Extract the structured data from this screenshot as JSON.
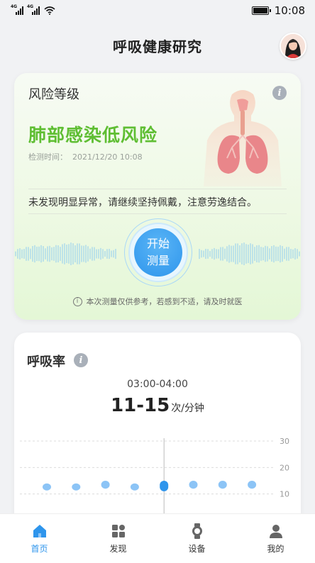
{
  "status_bar": {
    "network1": "4G",
    "network2": "4G",
    "time": "10:08"
  },
  "header": {
    "title": "呼吸健康研究"
  },
  "risk_card": {
    "label": "风险等级",
    "level": "肺部感染低风险",
    "time_label": "检测时间：",
    "time_value": "2021/12/20 10:08",
    "advice": "未发现明显异常，请继续坚持佩戴，注意劳逸结合。",
    "start_line1": "开始",
    "start_line2": "测量",
    "disclaimer": "本次测量仅供参考，若感到不适，请及时就医",
    "level_color": "#5fbe33"
  },
  "resp_card": {
    "title": "呼吸率",
    "time_range": "03:00-04:00",
    "value": "11-15",
    "unit": "次/分钟"
  },
  "chart_data": {
    "type": "range",
    "y_ticks": [
      "30",
      "20",
      "10"
    ],
    "ylim": [
      0,
      30
    ],
    "points": [
      {
        "low": 12,
        "high": 14
      },
      {
        "low": 12,
        "high": 14
      },
      {
        "low": 12,
        "high": 15
      },
      {
        "low": 12,
        "high": 14
      },
      {
        "low": 11,
        "high": 15
      },
      {
        "low": 12,
        "high": 15
      },
      {
        "low": 12,
        "high": 15
      },
      {
        "low": 12,
        "high": 15
      }
    ],
    "selected_index": 4,
    "colors": {
      "normal": "#8cc4f6",
      "selected": "#2e95ec"
    }
  },
  "tabbar": {
    "items": [
      {
        "label": "首页",
        "icon": "home-icon"
      },
      {
        "label": "发现",
        "icon": "discover-icon"
      },
      {
        "label": "设备",
        "icon": "watch-icon"
      },
      {
        "label": "我的",
        "icon": "user-icon"
      }
    ],
    "active": 0
  }
}
